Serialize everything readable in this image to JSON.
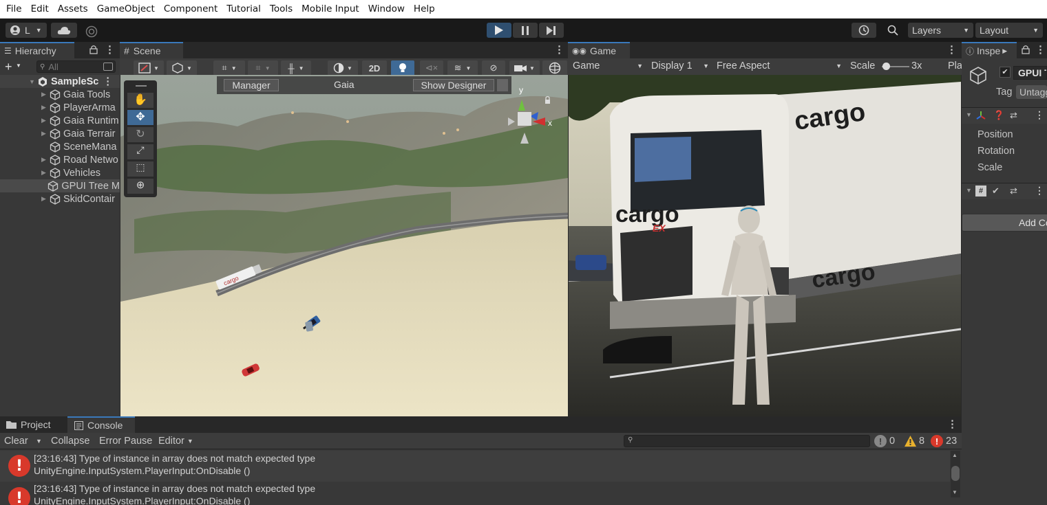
{
  "menu": [
    "File",
    "Edit",
    "Assets",
    "GameObject",
    "Component",
    "Tutorial",
    "Tools",
    "Mobile Input",
    "Window",
    "Help"
  ],
  "toolbar": {
    "account_label": "L",
    "layers_label": "Layers",
    "layout_label": "Layout"
  },
  "hierarchy": {
    "tab_label": "Hierarchy",
    "search_placeholder": "All",
    "scene_name": "SampleSc",
    "items": [
      {
        "label": "Gaia Tools",
        "has_children": true
      },
      {
        "label": "PlayerArma",
        "has_children": true
      },
      {
        "label": "Gaia Runtim",
        "has_children": true
      },
      {
        "label": "Gaia Terrair",
        "has_children": true
      },
      {
        "label": "SceneMana",
        "has_children": false
      },
      {
        "label": "Road Netwo",
        "has_children": true
      },
      {
        "label": "Vehicles",
        "has_children": true
      },
      {
        "label": "GPUI Tree M",
        "has_children": false,
        "selected": true
      },
      {
        "label": "SkidContair",
        "has_children": true
      }
    ]
  },
  "scene": {
    "tab_label": "Scene",
    "button_2d": "2D",
    "overlay": {
      "manager": "Manager",
      "title": "Gaia",
      "show_designer": "Show Designer"
    },
    "gizmo_y": "y",
    "gizmo_x": "x",
    "vehicle_text": "cargo"
  },
  "game": {
    "tab_label": "Game",
    "mode_select": "Game",
    "display_select": "Display 1",
    "aspect_select": "Free Aspect",
    "scale_label": "Scale",
    "scale_value": "3x",
    "play_label": "Pla",
    "truck_brand": "cargo",
    "truck_brand_suffix": "EX"
  },
  "inspector": {
    "tab_label": "Inspe",
    "object_name": "GPUI T",
    "tag_label": "Tag",
    "tag_value": "Untagged",
    "transform_fields": [
      "Position",
      "Rotation",
      "Scale"
    ],
    "add_component": "Add Component"
  },
  "console": {
    "tabs": {
      "project": "Project",
      "console": "Console"
    },
    "toolbar": {
      "clear": "Clear",
      "collapse": "Collapse",
      "error_pause": "Error Pause",
      "editor": "Editor"
    },
    "counts": {
      "info": "0",
      "warnings": "8",
      "errors": "23"
    },
    "entries": [
      {
        "line1": "[23:16:43] Type of instance in array does not match expected type",
        "line2": "UnityEngine.InputSystem.PlayerInput:OnDisable ()"
      },
      {
        "line1": "[23:16:43] Type of instance in array does not match expected type",
        "line2": "UnityEngine.InputSystem.PlayerInput:OnDisable ()"
      }
    ]
  },
  "colors": {
    "editor_bg": "#383838",
    "accent": "#3a79bb",
    "error": "#d8392b",
    "warning": "#e8b12d"
  }
}
